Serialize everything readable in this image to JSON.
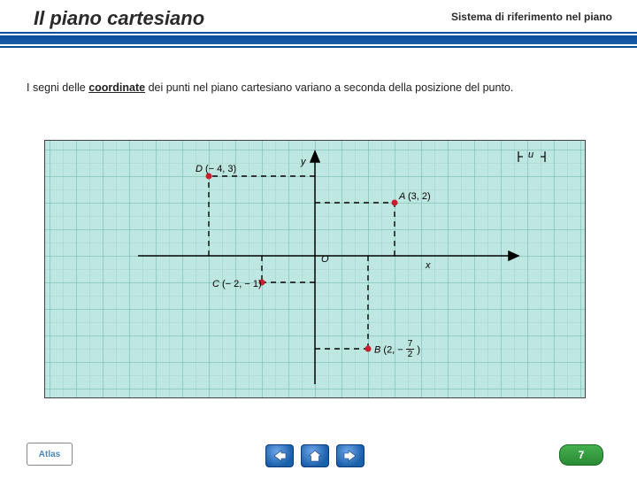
{
  "header": {
    "title": "Il piano cartesiano",
    "subtitle": "Sistema di riferimento nel piano"
  },
  "body_text_pre": "I segni delle ",
  "body_text_bold": "coordinate",
  "body_text_post": " dei punti nel piano cartesiano variano a seconda della posizione del punto.",
  "axes": {
    "x_label": "x",
    "y_label": "y",
    "origin_label": "O",
    "unit_label": "u"
  },
  "points": {
    "A": {
      "label": "A",
      "x": 3,
      "y": 2,
      "text": "(3, 2)"
    },
    "B": {
      "label": "B",
      "x": 2,
      "y": -3.5,
      "text_pre": "(2, − ",
      "frac_num": "7",
      "frac_den": "2",
      "text_post": " )"
    },
    "C": {
      "label": "C",
      "x": -2,
      "y": -1,
      "text": "(− 2, − 1)"
    },
    "D": {
      "label": "D",
      "x": -4,
      "y": 3,
      "text": "(− 4, 3)"
    }
  },
  "chart_data": {
    "type": "scatter",
    "title": "",
    "xlabel": "x",
    "ylabel": "y",
    "xlim": [
      -10,
      10
    ],
    "ylim": [
      -5,
      5
    ],
    "series": [
      {
        "name": "A",
        "x": [
          3
        ],
        "y": [
          2
        ]
      },
      {
        "name": "B",
        "x": [
          2
        ],
        "y": [
          -3.5
        ]
      },
      {
        "name": "C",
        "x": [
          -2
        ],
        "y": [
          -1
        ]
      },
      {
        "name": "D",
        "x": [
          -4
        ],
        "y": [
          3
        ]
      }
    ],
    "annotations": [
      "A (3, 2)",
      "B (2, −7/2)",
      "C (−2, −1)",
      "D (−4, 3)"
    ]
  },
  "logo_text": "Atlas",
  "page_number": "7"
}
